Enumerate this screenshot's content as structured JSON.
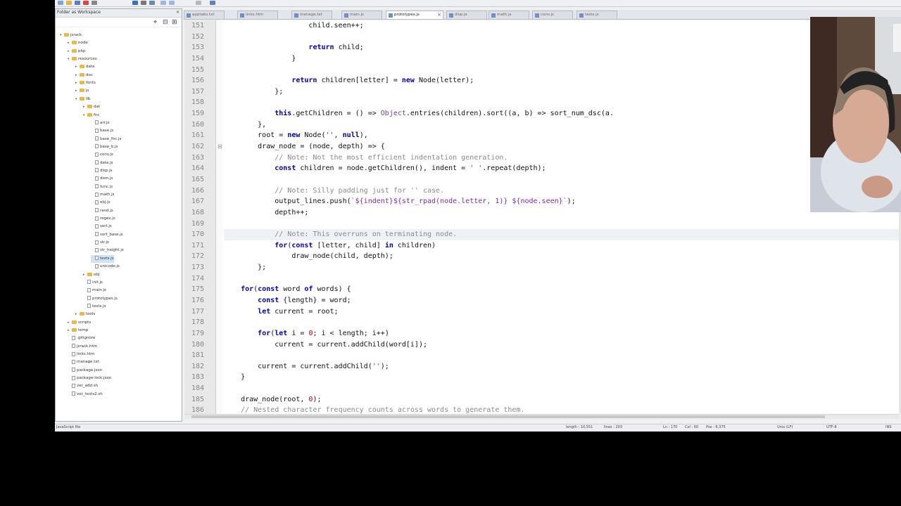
{
  "sidebar": {
    "title": "Folder as Workspace",
    "tree": [
      {
        "label": "jsrack",
        "depth": 0,
        "type": "folder",
        "open": true
      },
      {
        "label": "node",
        "depth": 1,
        "type": "folder"
      },
      {
        "label": "php",
        "depth": 1,
        "type": "folder"
      },
      {
        "label": "resources",
        "depth": 1,
        "type": "folder",
        "open": true
      },
      {
        "label": "data",
        "depth": 2,
        "type": "folder"
      },
      {
        "label": "doc",
        "depth": 2,
        "type": "folder"
      },
      {
        "label": "fonts",
        "depth": 2,
        "type": "folder"
      },
      {
        "label": "js",
        "depth": 2,
        "type": "folder"
      },
      {
        "label": "lib",
        "depth": 2,
        "type": "folder",
        "open": true
      },
      {
        "label": "dat",
        "depth": 3,
        "type": "folder"
      },
      {
        "label": "fnc",
        "depth": 3,
        "type": "folder",
        "open": true
      },
      {
        "label": "arr.js",
        "depth": 4,
        "type": "file"
      },
      {
        "label": "base.js",
        "depth": 4,
        "type": "file"
      },
      {
        "label": "base_fnc.js",
        "depth": 4,
        "type": "file"
      },
      {
        "label": "base_b.js",
        "depth": 4,
        "type": "file"
      },
      {
        "label": "conv.js",
        "depth": 4,
        "type": "file"
      },
      {
        "label": "date.js",
        "depth": 4,
        "type": "file"
      },
      {
        "label": "disp.js",
        "depth": 4,
        "type": "file"
      },
      {
        "label": "dom.js",
        "depth": 4,
        "type": "file"
      },
      {
        "label": "func.js",
        "depth": 4,
        "type": "file"
      },
      {
        "label": "math.js",
        "depth": 4,
        "type": "file"
      },
      {
        "label": "obj.js",
        "depth": 4,
        "type": "file"
      },
      {
        "label": "rand.js",
        "depth": 4,
        "type": "file"
      },
      {
        "label": "regex.js",
        "depth": 4,
        "type": "file"
      },
      {
        "label": "sort.js",
        "depth": 4,
        "type": "file"
      },
      {
        "label": "sort_base.js",
        "depth": 4,
        "type": "file"
      },
      {
        "label": "str.js",
        "depth": 4,
        "type": "file"
      },
      {
        "label": "str_height.js",
        "depth": 4,
        "type": "file"
      },
      {
        "label": "tests.js",
        "depth": 4,
        "type": "file",
        "selected": true
      },
      {
        "label": "unicode.js",
        "depth": 4,
        "type": "file"
      },
      {
        "label": "obj",
        "depth": 3,
        "type": "folder"
      },
      {
        "label": "init.js",
        "depth": 3,
        "type": "file"
      },
      {
        "label": "main.js",
        "depth": 3,
        "type": "file"
      },
      {
        "label": "prototypes.js",
        "depth": 3,
        "type": "file"
      },
      {
        "label": "tests.js",
        "depth": 3,
        "type": "file"
      },
      {
        "label": "tools",
        "depth": 2,
        "type": "folder"
      },
      {
        "label": "scripts",
        "depth": 1,
        "type": "folder"
      },
      {
        "label": "temp",
        "depth": 1,
        "type": "folder"
      },
      {
        "label": ".gitignore",
        "depth": 1,
        "type": "file"
      },
      {
        "label": "jsrack.htm",
        "depth": 1,
        "type": "file"
      },
      {
        "label": "links.htm",
        "depth": 1,
        "type": "file"
      },
      {
        "label": "manage.txt",
        "depth": 1,
        "type": "file"
      },
      {
        "label": "package.json",
        "depth": 1,
        "type": "file"
      },
      {
        "label": "package-lock.json",
        "depth": 1,
        "type": "file"
      },
      {
        "label": "ver_add.sh",
        "depth": 1,
        "type": "file"
      },
      {
        "label": "ver_tests2.sh",
        "depth": 1,
        "type": "file"
      }
    ]
  },
  "tabs": [
    {
      "label": "apptabs.txt",
      "active": false
    },
    {
      "label": "links.htm",
      "active": false
    },
    {
      "label": "manage.txt",
      "active": false
    },
    {
      "label": "main.js",
      "active": false
    },
    {
      "label": "prototypes.js",
      "active": true
    },
    {
      "label": "disp.js",
      "active": false
    },
    {
      "label": "math.js",
      "active": false
    },
    {
      "label": "conv.js",
      "active": false
    },
    {
      "label": "tests.js",
      "active": false
    }
  ],
  "editor": {
    "current_line": 170,
    "lines": [
      {
        "n": "151",
        "t": "                    child.seen++;"
      },
      {
        "n": "152",
        "t": ""
      },
      {
        "n": "153",
        "t": "                    return child;"
      },
      {
        "n": "154",
        "t": "                }"
      },
      {
        "n": "155",
        "t": ""
      },
      {
        "n": "156",
        "t": "                return children[letter] = new Node(letter);"
      },
      {
        "n": "157",
        "t": "            };"
      },
      {
        "n": "158",
        "t": ""
      },
      {
        "n": "159",
        "t": "            this.getChildren = () => Object.entries(children).sort((a, b) => sort_num_dsc(a."
      },
      {
        "n": "160",
        "t": "        },"
      },
      {
        "n": "161",
        "t": "        root = new Node('', null),"
      },
      {
        "n": "162",
        "t": "        draw_node = (node, depth) => {"
      },
      {
        "n": "163",
        "t": "            // Note: Not the most efficient indentation generation."
      },
      {
        "n": "164",
        "t": "            const children = node.getChildren(), indent = ' '.repeat(depth);"
      },
      {
        "n": "165",
        "t": ""
      },
      {
        "n": "166",
        "t": "            // Note: Silly padding just for '' case."
      },
      {
        "n": "167",
        "t": "            output_lines.push(`${indent}${str_rpad(node.letter, 1)} ${node.seen}`);"
      },
      {
        "n": "168",
        "t": "            depth++;"
      },
      {
        "n": "169",
        "t": ""
      },
      {
        "n": "170",
        "t": "            // Note: This overruns on terminating node."
      },
      {
        "n": "171",
        "t": "            for(const [letter, child] in children)"
      },
      {
        "n": "172",
        "t": "                draw_node(child, depth);"
      },
      {
        "n": "173",
        "t": "        };"
      },
      {
        "n": "174",
        "t": ""
      },
      {
        "n": "175",
        "t": "    for(const word of words) {"
      },
      {
        "n": "176",
        "t": "        const {length} = word;"
      },
      {
        "n": "177",
        "t": "        let current = root;"
      },
      {
        "n": "178",
        "t": ""
      },
      {
        "n": "179",
        "t": "        for(let i = 0; i < length; i++)"
      },
      {
        "n": "180",
        "t": "            current = current.addChild(word[i]);"
      },
      {
        "n": "181",
        "t": ""
      },
      {
        "n": "182",
        "t": "        current = current.addChild('');"
      },
      {
        "n": "183",
        "t": "    }"
      },
      {
        "n": "184",
        "t": ""
      },
      {
        "n": "185",
        "t": "    draw_node(root, 0);"
      },
      {
        "n": "186",
        "t": "    // Nested character frequency counts across words to generate them."
      }
    ]
  },
  "statusbar": {
    "file_type": "JavaScript file",
    "length": "length : 10,551",
    "lines": "lines : 203",
    "ln": "Ln : 170",
    "col": "Col : 60",
    "pos": "Pos : 6,375",
    "eol": "Unix (LF)",
    "encoding": "UTF-8",
    "mode": "INS"
  },
  "colors": {
    "keyword": "#0000b5",
    "comment": "#8a8a8a",
    "string": "#7a2aa8",
    "number": "#c40000",
    "selection": "#cde3f8"
  }
}
